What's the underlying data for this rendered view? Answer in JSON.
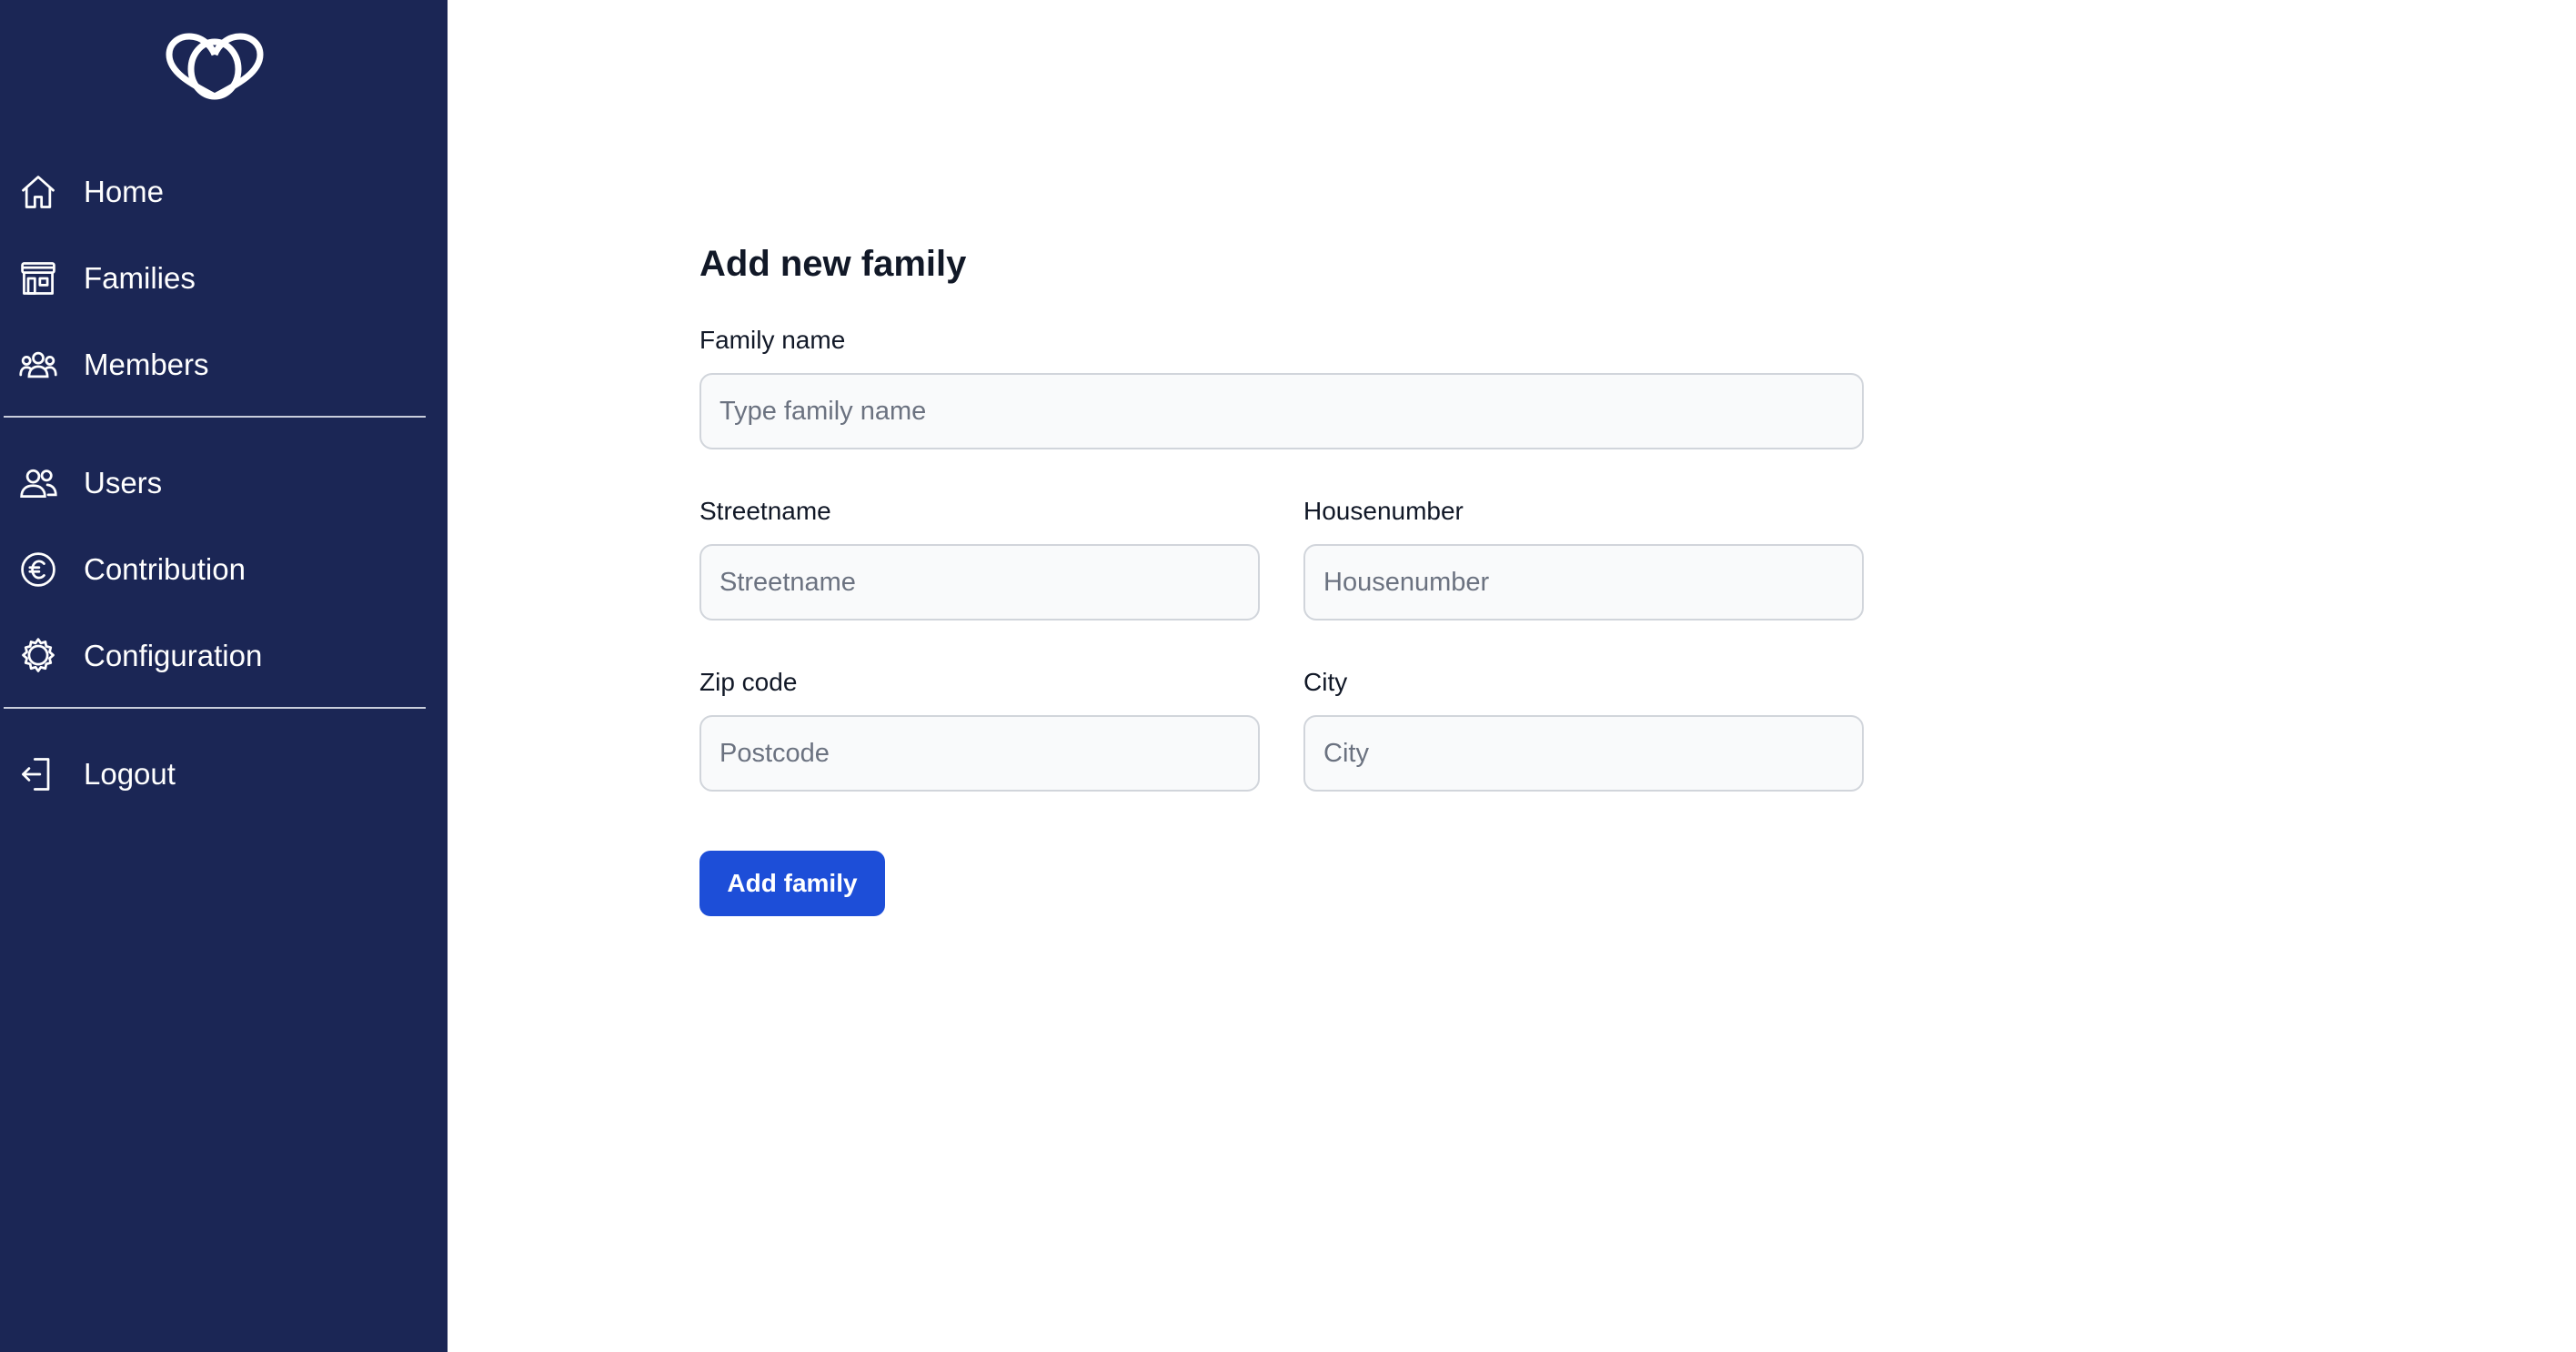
{
  "sidebar": {
    "logo_icon": "three-interlocking-rings-icon",
    "background_color": "#1b2655",
    "items": [
      {
        "label": "Home",
        "icon": "home-icon"
      },
      {
        "label": "Families",
        "icon": "storefront-icon"
      },
      {
        "label": "Members",
        "icon": "members-group-icon"
      },
      {
        "label": "Users",
        "icon": "users-icon"
      },
      {
        "label": "Contribution",
        "icon": "euro-circle-icon"
      },
      {
        "label": "Configuration",
        "icon": "gear-icon"
      },
      {
        "label": "Logout",
        "icon": "logout-icon"
      }
    ]
  },
  "form": {
    "title": "Add new family",
    "family_name": {
      "label": "Family name",
      "placeholder": "Type family name",
      "value": ""
    },
    "streetname": {
      "label": "Streetname",
      "placeholder": "Streetname",
      "value": ""
    },
    "housenumber": {
      "label": "Housenumber",
      "placeholder": "Housenumber",
      "value": ""
    },
    "zipcode": {
      "label": "Zip code",
      "placeholder": "Postcode",
      "value": ""
    },
    "city": {
      "label": "City",
      "placeholder": "City",
      "value": ""
    },
    "submit_label": "Add family",
    "accent_color": "#1d4ed8"
  }
}
